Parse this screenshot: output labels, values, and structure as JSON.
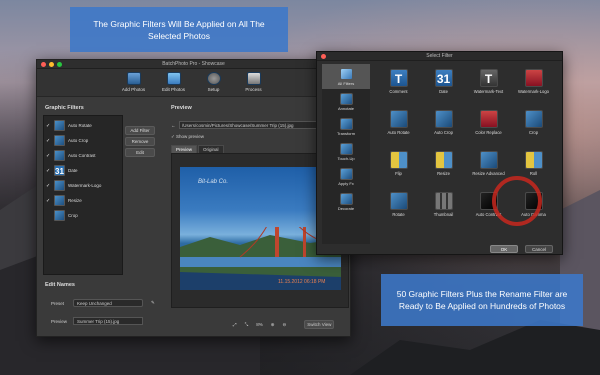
{
  "callouts": {
    "top": "The Graphic Filters Will Be Applied on All The Selected Photos",
    "bottom": "50 Graphic Filters Plus the Rename Filter are Ready to Be Applied on Hundreds of Photos"
  },
  "main_window": {
    "title": "BatchPhoto Pro - Showcase",
    "toolbar": [
      {
        "label": "Add Photos",
        "icon": "photos-icon"
      },
      {
        "label": "Edit Photos",
        "icon": "edit-photos-icon"
      },
      {
        "label": "Setup",
        "icon": "gear-icon"
      },
      {
        "label": "Process",
        "icon": "process-icon"
      }
    ],
    "graphic_filters_title": "Graphic Filters",
    "filters": [
      {
        "checked": "✓",
        "label": "Auto Rotate",
        "icon": "auto-rotate-icon"
      },
      {
        "checked": "✓",
        "label": "Auto Crop",
        "icon": "auto-crop-icon"
      },
      {
        "checked": "✓",
        "label": "Auto Contrast",
        "icon": "auto-contrast-icon"
      },
      {
        "checked": "✓",
        "label": "Date",
        "icon": "date-icon"
      },
      {
        "checked": "✓",
        "label": "Watermark-Logo",
        "icon": "watermark-logo-icon"
      },
      {
        "checked": "✓",
        "label": "Resize",
        "icon": "resize-icon"
      },
      {
        "checked": "",
        "label": "Crop",
        "icon": "crop-icon"
      }
    ],
    "buttons": {
      "add": "Add Filter",
      "remove": "Remove",
      "edit": "Edit"
    },
    "edit_names_title": "Edit Names",
    "preset_label": "Preset",
    "preset_value": "Keep Unchanged",
    "preview_label": "Preview",
    "preview_value": "Summer Trip (15).jpg",
    "preview_title": "Preview",
    "path": "/Users/cosmin/Pictures/Showcase/Summer Trip (15).jpg",
    "show_preview": "Show preview",
    "tabs": [
      "Preview",
      "Original"
    ],
    "watermark": "Bit-Lab Co.",
    "datestamp": "11.15.2012 06:18 PM",
    "zoom": "8%",
    "switch_view": "Switch View"
  },
  "filter_window": {
    "title": "Select Filter",
    "categories": [
      {
        "label": "All Filters",
        "icon": "all-filters-icon"
      },
      {
        "label": "Annotate",
        "icon": "annotate-icon"
      },
      {
        "label": "Transform",
        "icon": "transform-icon"
      },
      {
        "label": "Touch-Up",
        "icon": "touch-up-icon"
      },
      {
        "label": "Apply Fx",
        "icon": "apply-fx-icon"
      },
      {
        "label": "Decorate",
        "icon": "decorate-icon"
      }
    ],
    "filters": [
      {
        "label": "Comment",
        "glyph": "T"
      },
      {
        "label": "Date",
        "glyph": "31"
      },
      {
        "label": "Watermark-Text",
        "glyph": "T"
      },
      {
        "label": "Watermark-Logo",
        "glyph": ""
      },
      {
        "label": "Auto Rotate",
        "glyph": ""
      },
      {
        "label": "Auto Crop",
        "glyph": ""
      },
      {
        "label": "Color Replace",
        "glyph": ""
      },
      {
        "label": "Crop",
        "glyph": ""
      },
      {
        "label": "Flip",
        "glyph": ""
      },
      {
        "label": "Resize",
        "glyph": ""
      },
      {
        "label": "Resize Advanced",
        "glyph": ""
      },
      {
        "label": "Roll",
        "glyph": ""
      },
      {
        "label": "Rotate",
        "glyph": ""
      },
      {
        "label": "Thumbnail",
        "glyph": ""
      },
      {
        "label": "Auto Contrast",
        "glyph": ""
      },
      {
        "label": "Auto Gamma",
        "glyph": ""
      }
    ],
    "ok": "OK",
    "cancel": "Cancel"
  }
}
